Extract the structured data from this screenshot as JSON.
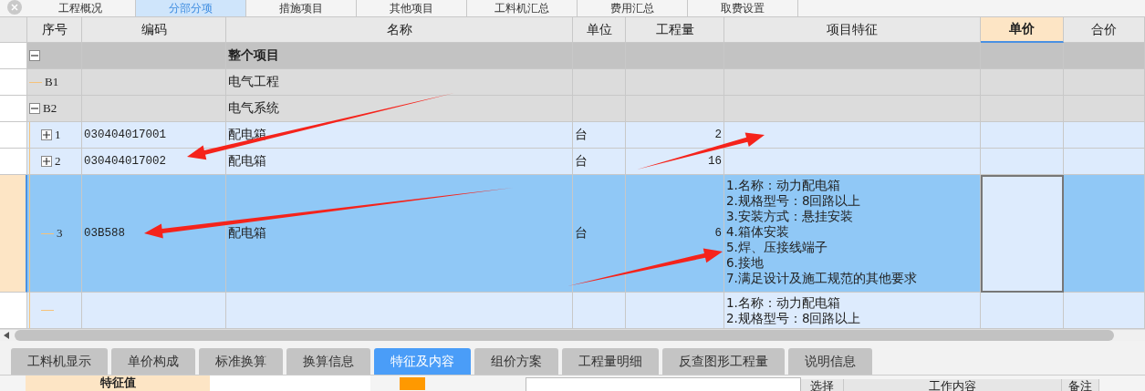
{
  "top_tabs": [
    {
      "label": "工程概况",
      "selected": false
    },
    {
      "label": "分部分项",
      "selected": true
    },
    {
      "label": "措施项目",
      "selected": false
    },
    {
      "label": "其他项目",
      "selected": false
    },
    {
      "label": "工料机汇总",
      "selected": false
    },
    {
      "label": "费用汇总",
      "selected": false
    },
    {
      "label": "取费设置",
      "selected": false
    }
  ],
  "table": {
    "columns": [
      {
        "label": "序号",
        "selected": false
      },
      {
        "label": "编码",
        "selected": false
      },
      {
        "label": "名称",
        "selected": false
      },
      {
        "label": "单位",
        "selected": false
      },
      {
        "label": "工程量",
        "selected": false
      },
      {
        "label": "项目特征",
        "selected": false
      },
      {
        "label": "单价",
        "selected": true
      },
      {
        "label": "合价",
        "selected": false
      }
    ],
    "rows": [
      {
        "kind": "root",
        "name": "整个项目",
        "expanded": true,
        "selected": false,
        "children": [
          {
            "kind": "section",
            "number": "B1",
            "name": "电气工程",
            "selected": false
          },
          {
            "kind": "section",
            "number": "B2",
            "name": "电气系统",
            "expanded": true,
            "selected": false,
            "children": [
              {
                "kind": "item",
                "number": "1",
                "code": "030404017001",
                "name": "配电箱",
                "unit": "台",
                "quantity": "2",
                "expanded": false,
                "selected": false
              },
              {
                "kind": "item",
                "number": "2",
                "code": "030404017002",
                "name": "配电箱",
                "unit": "台",
                "quantity": "16",
                "expanded": false,
                "selected": false
              },
              {
                "kind": "item",
                "number": "3",
                "code": "03B588",
                "name": "配电箱",
                "unit": "台",
                "quantity": "6",
                "selected": true,
                "features": [
                  "1.名称：动力配电箱",
                  "2.规格型号：8回路以上",
                  "3.安装方式：悬挂安装",
                  "4.箱体安装",
                  "5.焊、压接线端子",
                  "6.接地",
                  "7.满足设计及施工规范的其他要求"
                ]
              },
              {
                "kind": "item",
                "selected": false,
                "features": [
                  "1.名称：动力配电箱",
                  "2.规格型号：8回路以上"
                ]
              }
            ]
          }
        ]
      }
    ]
  },
  "bottom_tabs": [
    {
      "label": "工料机显示",
      "selected": false
    },
    {
      "label": "单价构成",
      "selected": false
    },
    {
      "label": "标准换算",
      "selected": false
    },
    {
      "label": "换算信息",
      "selected": false
    },
    {
      "label": "特征及内容",
      "selected": true
    },
    {
      "label": "组价方案",
      "selected": false
    },
    {
      "label": "工程量明细",
      "selected": false
    },
    {
      "label": "反查图形工程量",
      "selected": false
    },
    {
      "label": "说明信息",
      "selected": false
    }
  ],
  "feature_panel": {
    "header": "特征值"
  },
  "content_panel": {
    "columns": [
      "选择",
      "工作内容",
      "备注"
    ]
  }
}
